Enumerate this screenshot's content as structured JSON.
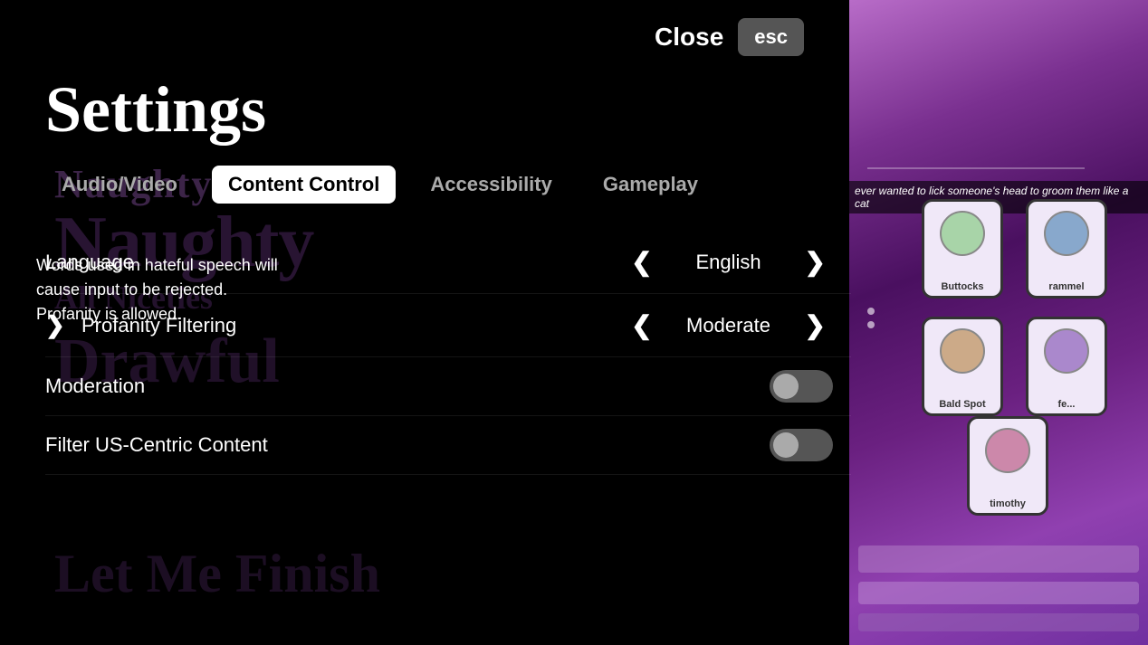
{
  "app": {
    "title": "Settings"
  },
  "close_button": {
    "label": "Close",
    "shortcut": "esc"
  },
  "tabs": [
    {
      "id": "audio-video",
      "label": "Audio/Video",
      "active": false
    },
    {
      "id": "content-control",
      "label": "Content Control",
      "active": true
    },
    {
      "id": "accessibility",
      "label": "Accessibility",
      "active": false
    },
    {
      "id": "gameplay",
      "label": "Gameplay",
      "active": false
    }
  ],
  "rows": [
    {
      "id": "language",
      "label": "Language",
      "type": "value-picker",
      "value": "English",
      "has_left_arrow": true,
      "has_right_arrow": true,
      "has_indicator": false
    },
    {
      "id": "profanity-filtering",
      "label": "Profanity Filtering",
      "type": "value-picker",
      "value": "Moderate",
      "has_left_arrow": true,
      "has_right_arrow": true,
      "has_indicator": true
    },
    {
      "id": "moderation",
      "label": "Moderation",
      "type": "toggle",
      "value": "off"
    },
    {
      "id": "filter-us-centric",
      "label": "Filter US-Centric Content",
      "type": "toggle",
      "value": "off"
    }
  ],
  "tooltip": {
    "text": "Words used in hateful speech will cause input to be rejected. Profanity is allowed."
  },
  "background_texts": [
    "Naughty Phrase",
    "Drawful",
    "All Niceties",
    "Let Me Finish"
  ],
  "game_panel": {
    "scroll_text": "ever wanted to lick someone's head to groom them like a cat",
    "cards": [
      {
        "label": "Buttocks",
        "color": "#d4ecd4"
      },
      {
        "label": "rammel",
        "color": "#c8d8ec"
      },
      {
        "label": "Bald Spot",
        "color": "#ecdcd4"
      },
      {
        "label": "fe...",
        "color": "#d4c8ec"
      },
      {
        "label": "timothy",
        "color": "#ecd4ec"
      }
    ]
  }
}
